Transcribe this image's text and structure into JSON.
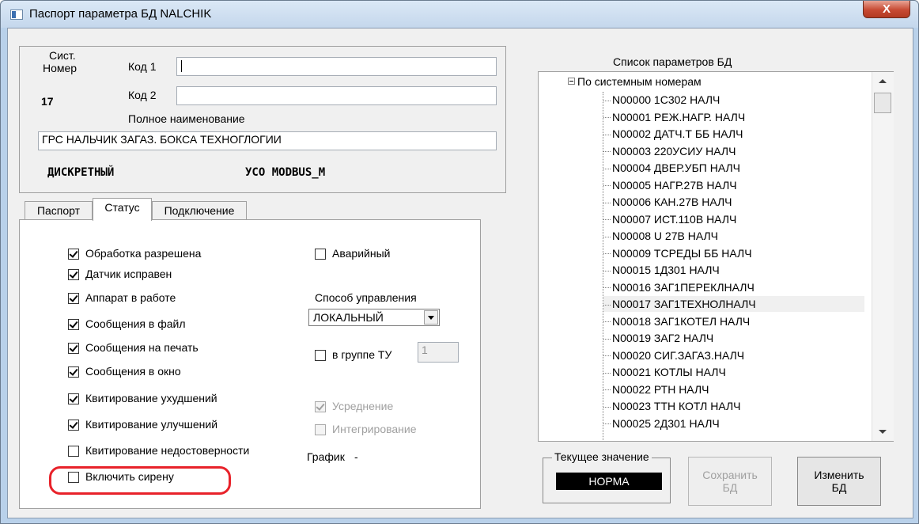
{
  "window": {
    "title": "Паспорт параметра БД NALCHIK",
    "close_label": "X"
  },
  "header": {
    "sys_label_line1": "Сист.",
    "sys_label_line2": "Номер",
    "sys_number": "17",
    "code1_label": "Код 1",
    "code1_value": "",
    "code2_label": "Код 2",
    "code2_value": "",
    "fullname_label": "Полное наименование",
    "fullname_value": "ГРС НАЛЬЧИК ЗАГАЗ. БОКСА ТЕХНОГЛОГИИ",
    "type_text": "ДИСКРЕТНЫЙ",
    "uso_text": "УСО  MODBUS_M"
  },
  "tabs": [
    {
      "label": "Паспорт",
      "active": false
    },
    {
      "label": "Статус",
      "active": true
    },
    {
      "label": "Подключение",
      "active": false
    }
  ],
  "status": {
    "checkboxes": [
      {
        "label": "Обработка разрешена",
        "checked": true,
        "disabled": false
      },
      {
        "label": "Датчик исправен",
        "checked": true,
        "disabled": false
      },
      {
        "label": "Аппарат в работе",
        "checked": true,
        "disabled": false
      },
      {
        "label": "Сообщения в файл",
        "checked": true,
        "disabled": false
      },
      {
        "label": "Сообщения на печать",
        "checked": true,
        "disabled": false
      },
      {
        "label": "Сообщения в окно",
        "checked": true,
        "disabled": false
      },
      {
        "label": "Квитирование ухудшений",
        "checked": true,
        "disabled": false
      },
      {
        "label": "Квитирование улучшений",
        "checked": true,
        "disabled": false
      },
      {
        "label": "Квитирование недостоверности",
        "checked": false,
        "disabled": false
      },
      {
        "label": "Включить сирену",
        "checked": false,
        "disabled": false
      }
    ],
    "emergency": {
      "label": "Аварийный",
      "checked": false
    },
    "control_method_label": "Способ управления",
    "control_method_value": "ЛОКАЛЬНЫЙ",
    "tu_group": {
      "label": "в группе ТУ",
      "checked": false,
      "value": "1"
    },
    "averaging": {
      "label": "Усреднение",
      "checked": true,
      "disabled": true
    },
    "integration": {
      "label": "Интегрирование",
      "checked": false,
      "disabled": true
    },
    "graph_label": "График",
    "graph_value": "-"
  },
  "param_list": {
    "title": "Список параметров БД",
    "root_label": "По системным номерам",
    "items": [
      "N00000 1С302   НАЛЧ",
      "N00001 РЕЖ.НАГР. НАЛЧ",
      "N00002 ДАТЧ.Т ББ НАЛЧ",
      "N00003 220УСИУ  НАЛЧ",
      "N00004 ДВЕР.УБП  НАЛЧ",
      "N00005 НАГР.27В  НАЛЧ",
      "N00006 КАН.27В  НАЛЧ",
      "N00007 ИСТ.110В  НАЛЧ",
      "N00008 U 27В     НАЛЧ",
      "N00009 ТСРЕДЫ ББ НАЛЧ",
      "N00015 1Д301   НАЛЧ",
      "N00016 ЗАГ1ПЕРЕКЛНАЛЧ",
      "N00017 ЗАГ1ТЕХНОЛНАЛЧ",
      "N00018 ЗАГ1КОТЕЛ НАЛЧ",
      "N00019 ЗАГ2     НАЛЧ",
      "N00020 СИГ.ЗАГАЗ.НАЛЧ",
      "N00021 КОТЛЫ    НАЛЧ",
      "N00022 РТН      НАЛЧ",
      "N00023 ТТН КОТЛ  НАЛЧ",
      "N00025 2Д301   НАЛЧ"
    ],
    "selected_index": 12
  },
  "current_value": {
    "label": "Текущее значение",
    "value": "НОРМА"
  },
  "buttons": {
    "save": "Сохранить\nБД",
    "change": "Изменить\nБД"
  },
  "colors": {
    "highlight": "#e8222a",
    "titlebar": "#c4d7ec",
    "close": "#c74a33"
  }
}
